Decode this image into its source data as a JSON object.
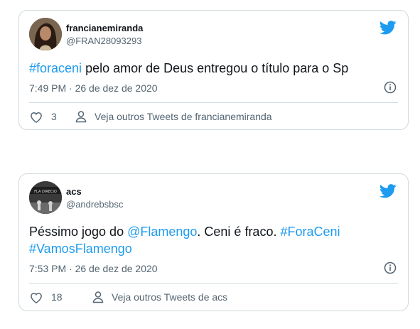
{
  "tweets": [
    {
      "display_name": "francianemiranda",
      "handle": "@FRAN28093293",
      "text": [
        {
          "text": "#foraceni",
          "link": true
        },
        {
          "text": " pelo amor de Deus entregou o título para o Sp",
          "link": false
        }
      ],
      "timestamp": "7:49 PM · 26 de dez de 2020",
      "likes": "3",
      "more_link": "Veja outros Tweets de francianemiranda"
    },
    {
      "display_name": "acs",
      "handle": "@andrebsbsc",
      "avatar_text": "FLA DIRECIO",
      "text": [
        {
          "text": "Péssimo jogo do ",
          "link": false
        },
        {
          "text": "@Flamengo",
          "link": true
        },
        {
          "text": ". Ceni é fraco. ",
          "link": false
        },
        {
          "text": "#ForaCeni",
          "link": true
        },
        {
          "text": " ",
          "link": false
        },
        {
          "text": "#VamosFlamengo",
          "link": true
        }
      ],
      "timestamp": "7:53 PM · 26 de dez de 2020",
      "likes": "18",
      "more_link": "Veja outros Tweets de acs"
    }
  ],
  "colors": {
    "link": "#1d9bf0",
    "text": "#0f1419",
    "secondary": "#536471",
    "border": "#cfd9de"
  },
  "icons": [
    "twitter-bird-icon",
    "info-icon",
    "heart-icon",
    "person-icon"
  ]
}
